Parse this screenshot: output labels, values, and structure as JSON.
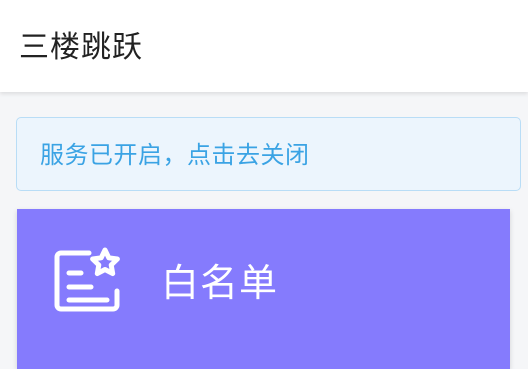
{
  "app_bar": {
    "title": "三楼跳跃"
  },
  "service_notice": {
    "text": "服务已开启，点击去关闭"
  },
  "whitelist_card": {
    "label": "白名单",
    "icon": "whitelist-icon",
    "background_color": "#857bfd"
  },
  "colors": {
    "notice_text": "#3aa3e4",
    "notice_background": "#ecf5fd",
    "notice_border": "#b9ddf6"
  }
}
